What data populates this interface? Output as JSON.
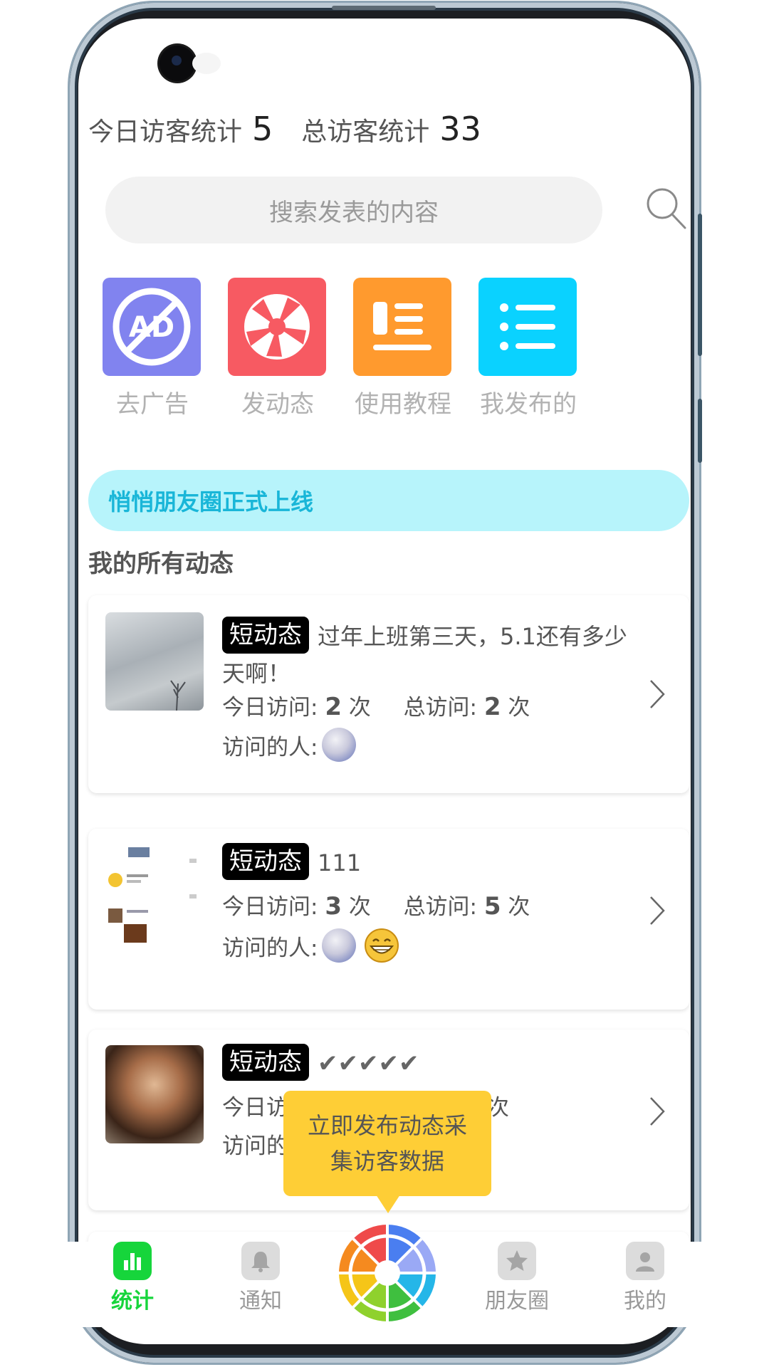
{
  "stats": {
    "today_label": "今日访客统计",
    "today_value": "5",
    "total_label": "总访客统计",
    "total_value": "33"
  },
  "search": {
    "placeholder": "搜索发表的内容"
  },
  "quick_actions": [
    {
      "label": "去广告",
      "icon": "no-ad-icon",
      "color": "#8183ef"
    },
    {
      "label": "发动态",
      "icon": "aperture-icon",
      "color": "#f75a62"
    },
    {
      "label": "使用教程",
      "icon": "tutorial-icon",
      "color": "#ff9a2e"
    },
    {
      "label": "我发布的",
      "icon": "list-icon",
      "color": "#0ad2ff"
    }
  ],
  "banner": {
    "text": "悄悄朋友圈正式上线"
  },
  "section_title": "我的所有动态",
  "posts": [
    {
      "tag": "短动态",
      "text": "过年上班第三天，5.1还有多少天啊！",
      "today_label": "今日访问: ",
      "today_count": "2",
      "today_unit": " 次",
      "total_label": "总访问: ",
      "total_count": "2",
      "total_unit": " 次",
      "visitors_label": "访问的人:"
    },
    {
      "tag": "短动态",
      "text": "111",
      "today_label": "今日访问: ",
      "today_count": "3",
      "today_unit": " 次",
      "total_label": "总访问: ",
      "total_count": "5",
      "total_unit": " 次",
      "visitors_label": "访问的人:"
    },
    {
      "tag": "短动态",
      "text": "✔✔✔✔✔",
      "today_label": "今日访",
      "total_unit": "次",
      "visitors_label": "访问的"
    }
  ],
  "tooltip": {
    "line1": "立即发布动态采",
    "line2": "集访客数据"
  },
  "tabs": [
    {
      "label": "统计",
      "icon": "bar-chart-icon"
    },
    {
      "label": "通知",
      "icon": "bell-icon"
    },
    {
      "label": "朋友圈",
      "icon": "star-icon"
    },
    {
      "label": "我的",
      "icon": "user-icon"
    }
  ],
  "colors": {
    "active_green": "#16d53b",
    "banner_bg": "#b7f4fb",
    "banner_text": "#19b6d8",
    "tooltip_bg": "#fece36"
  }
}
